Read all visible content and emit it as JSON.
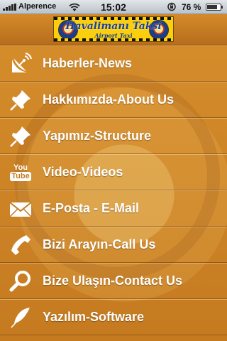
{
  "status_bar": {
    "carrier": "Alperence",
    "time": "15:02",
    "battery_percent": "76 %",
    "battery_level": 0.76,
    "signal_bars": 5
  },
  "header": {
    "logo_title": "Havalimanı Taksi",
    "logo_subtitle": "Airport Taxi"
  },
  "menu": {
    "items": [
      {
        "label": "Haberler-News",
        "icon": "satellite-dish-icon"
      },
      {
        "label": "Hakkımızda-About Us",
        "icon": "pushpin-icon"
      },
      {
        "label": "Yapımız-Structure",
        "icon": "pushpin-icon"
      },
      {
        "label": "Video-Videos",
        "icon": "youtube-icon",
        "icon_text_top": "You",
        "icon_text_bottom": "Tube"
      },
      {
        "label": "E-Posta - E-Mail",
        "icon": "envelope-icon"
      },
      {
        "label": "Bizi Arayın-Call Us",
        "icon": "phone-icon"
      },
      {
        "label": "Bize Ulaşın-Contact Us",
        "icon": "magnifier-icon"
      },
      {
        "label": "Yazılım-Software",
        "icon": "feather-icon"
      }
    ]
  },
  "colors": {
    "background": "#d8952d",
    "logo_yellow": "#fbcf0d",
    "logo_text": "#1a3f96",
    "menu_text": "#ffffff"
  }
}
